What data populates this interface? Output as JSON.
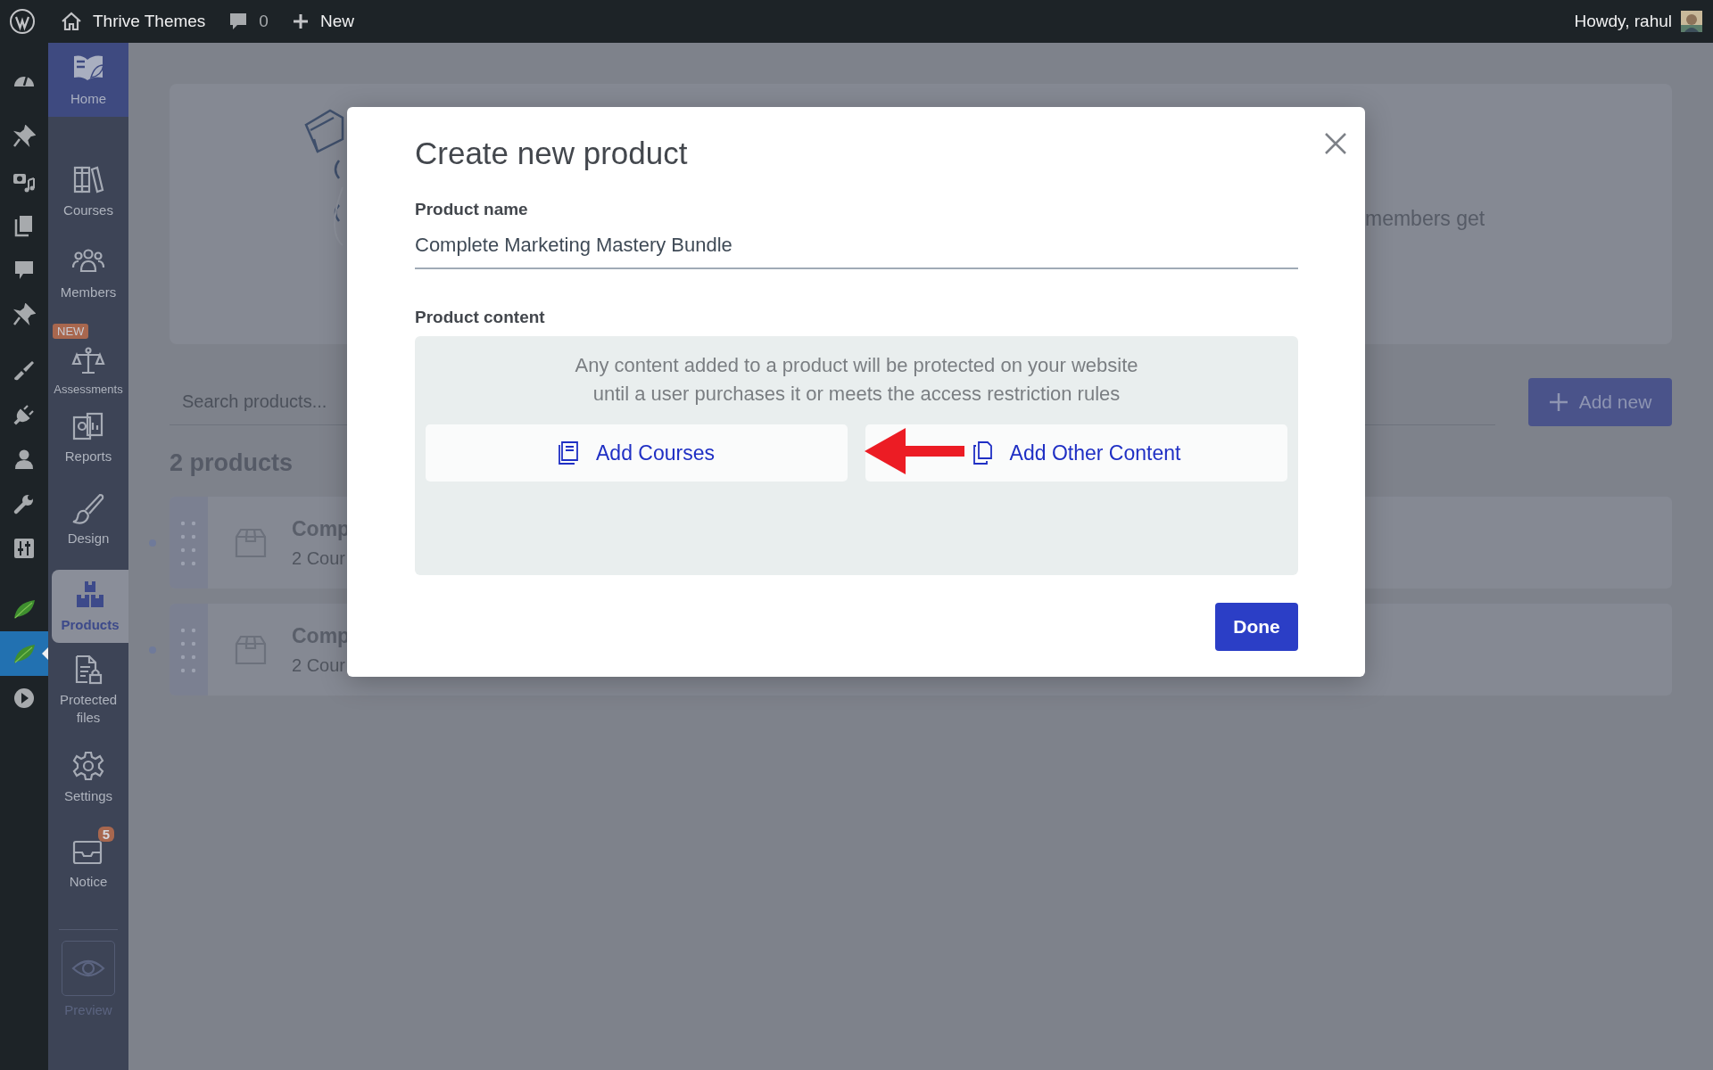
{
  "admin_bar": {
    "site": "Thrive Themes",
    "comments": "0",
    "new": "New",
    "greeting": "Howdy, rahul"
  },
  "admin_menu": [
    {
      "kind": "dashboard",
      "selected": false
    },
    {
      "kind": "pin",
      "selected": false
    },
    {
      "kind": "media",
      "selected": false
    },
    {
      "kind": "pages",
      "selected": false
    },
    {
      "kind": "comments",
      "selected": false
    },
    {
      "kind": "pin",
      "selected": false
    },
    {
      "kind": "brush",
      "selected": false
    },
    {
      "kind": "plugin",
      "selected": false
    },
    {
      "kind": "user",
      "selected": false
    },
    {
      "kind": "wrench",
      "selected": false
    },
    {
      "kind": "sliders",
      "selected": false
    },
    {
      "kind": "leaf",
      "selected": false
    },
    {
      "kind": "leaf",
      "selected": true
    },
    {
      "kind": "play",
      "selected": false
    }
  ],
  "plugin_nav": [
    {
      "kind": "home",
      "label": "Home",
      "selected": false
    },
    {
      "kind": "courses",
      "label": "Courses",
      "selected": false
    },
    {
      "kind": "members",
      "label": "Members",
      "selected": false
    },
    {
      "kind": "assessments",
      "label": "Assessments",
      "selected": false,
      "badge": "NEW"
    },
    {
      "kind": "reports",
      "label": "Reports",
      "selected": false
    },
    {
      "kind": "design",
      "label": "Design",
      "selected": false
    },
    {
      "kind": "products",
      "label": "Products",
      "selected": true
    },
    {
      "kind": "protected",
      "label": "Protected\nfiles",
      "selected": false
    },
    {
      "kind": "settings",
      "label": "Settings",
      "selected": false
    },
    {
      "kind": "notice",
      "label": "Notice",
      "selected": false,
      "badge": "5"
    },
    {
      "kind": "preview",
      "label": "Preview",
      "selected": false
    }
  ],
  "hero": {
    "text": "members get"
  },
  "search": {
    "placeholder": "Search products..."
  },
  "add_button": "Add new",
  "count_heading": "2 products",
  "products": [
    {
      "name": "Comp",
      "courses": "2 Cour"
    },
    {
      "name": "Comp",
      "courses": "2 Cour"
    }
  ],
  "modal": {
    "title": "Create new product",
    "name_label": "Product name",
    "name_value": "Complete Marketing Mastery Bundle",
    "content_label": "Product content",
    "content_note": "Any content added to a product will be protected on your website\nuntil a user purchases it or meets the access restriction rules",
    "buttons": [
      {
        "kind": "courses",
        "label": "Add Courses"
      },
      {
        "kind": "other",
        "label": "Add Other Content"
      }
    ],
    "done": "Done"
  }
}
